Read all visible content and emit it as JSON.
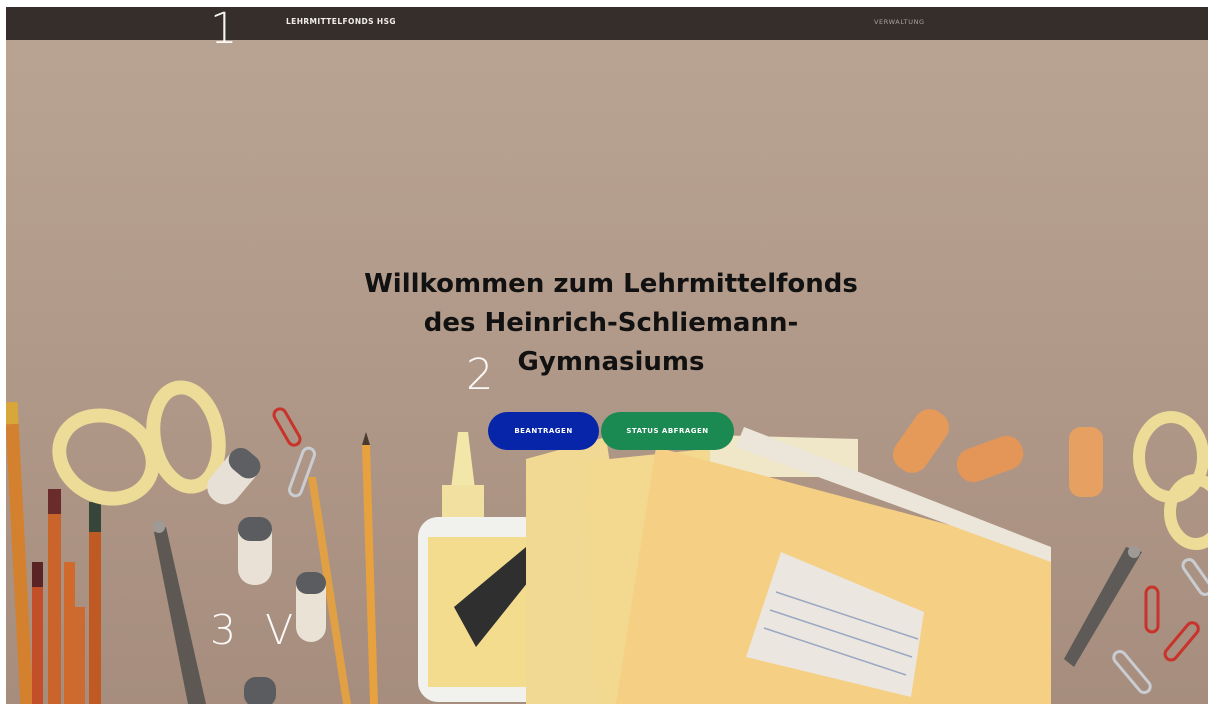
{
  "nav": {
    "brand": "LEHRMITTELFONDS HSG",
    "admin_link": "VERWALTUNG"
  },
  "hero": {
    "title_lines": [
      "Willkommen zum Lehrmittelfonds",
      "des Heinrich-Schliemann-",
      "Gymnasiums"
    ],
    "apply_button": "BEANTRAGEN",
    "status_button": "STATUS ABFRAGEN",
    "background": "school-supplies-photo"
  },
  "markers": {
    "m1": "1",
    "m2": "2",
    "m3": "3 V"
  },
  "colors": {
    "nav_bg": "#352e2a",
    "hero_bg": "#b49c8b",
    "apply": "#0725a8",
    "status": "#1b8a52"
  }
}
